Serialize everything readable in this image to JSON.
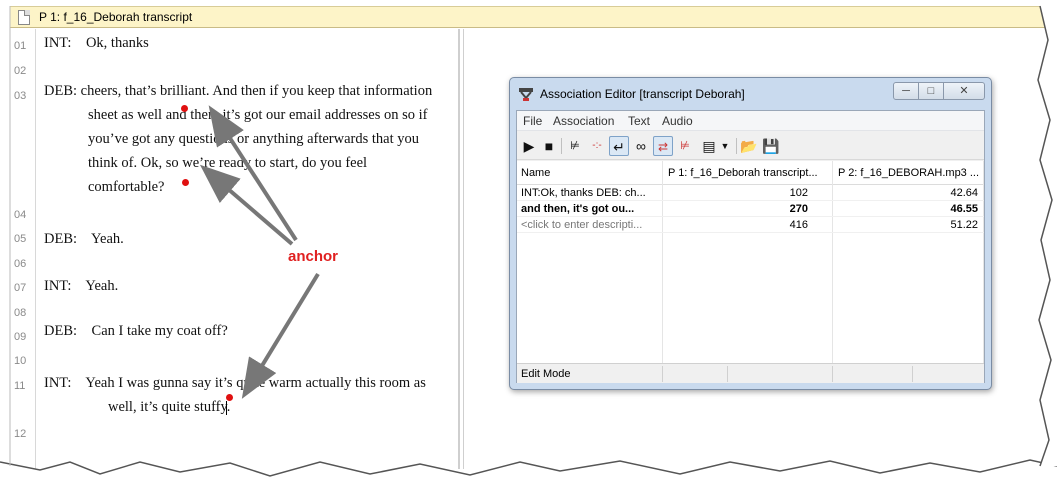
{
  "document": {
    "title": "P 1: f_16_Deborah transcript",
    "line_numbers": [
      "01",
      "02",
      "03",
      "04",
      "05",
      "06",
      "07",
      "08",
      "09",
      "10",
      "11",
      "12"
    ],
    "transcript_lines": [
      "INT:    Ok, thanks",
      "DEB: cheers,  that’s brilliant. And then if you keep that information",
      "sheet as well and then, it’s got our email addresses on so if",
      "you’ve got any questions or anything afterwards that you",
      "think of. Ok, so we’re ready to start, do you feel",
      "comfortable?",
      "DEB:    Yeah.",
      "INT:    Yeah.",
      "DEB:    Can I take my coat off?",
      "INT:    Yeah I was gunna say it’s quite warm actually this room as",
      "well, it’s quite stuffy."
    ],
    "annotation": "anchor"
  },
  "association_editor": {
    "title": "Association Editor [transcript Deborah]",
    "window_buttons": [
      "minimize",
      "maximize",
      "close"
    ],
    "menu": [
      "File",
      "Association",
      "Text",
      "Audio"
    ],
    "toolbar_icons": [
      "play-icon",
      "stop-icon",
      "associate-icon",
      "split-icon",
      "undo-icon",
      "link-icon",
      "sync-icon",
      "waveform-icon",
      "view-icon",
      "dropdown-icon",
      "open-folder-icon",
      "save-icon"
    ],
    "columns": [
      "Name",
      "P 1: f_16_Deborah transcript...",
      "P 2: f_16_DEBORAH.mp3 ..."
    ],
    "rows": [
      {
        "name": "INT:Ok, thanks DEB: ch...",
        "text_pos": "102",
        "audio_pos": "42.64",
        "bold": false
      },
      {
        "name": "and then, it's got ou...",
        "text_pos": "270",
        "audio_pos": "46.55",
        "bold": true
      },
      {
        "name": "<click to enter descripti...",
        "text_pos": "416",
        "audio_pos": "51.22",
        "bold": false
      }
    ],
    "status": "Edit Mode"
  },
  "colors": {
    "title_bar_bg": "#fdf4c8",
    "anchor_red": "#e02020",
    "window_frame": "#c9daee"
  }
}
